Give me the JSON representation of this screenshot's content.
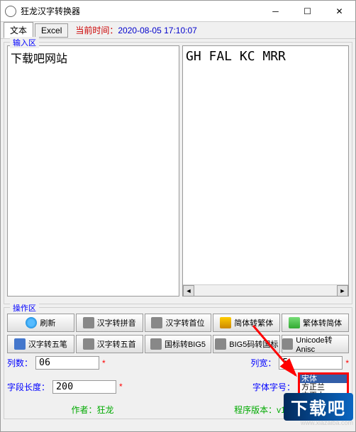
{
  "window": {
    "title": "狂龙汉字转换器"
  },
  "tabs": {
    "text": "文本",
    "excel": "Excel"
  },
  "time": {
    "label": "当前时间：",
    "value": "2020-08-05  17:10:07"
  },
  "sections": {
    "input": "输入区",
    "ops": "操作区"
  },
  "inputText": "下载吧网站",
  "outputText": "GH FAL KC MRR",
  "buttonsRow1": {
    "refresh": "刷新",
    "hz2py": "汉字转拼音",
    "hz2sw": "汉字转首位",
    "s2t": "简体转繁体",
    "t2s": "繁体转简体"
  },
  "buttonsRow2": {
    "hz2wb": "汉字转五笔",
    "hz2ws": "汉字转五首",
    "gb2b5": "国标转BIG5",
    "b52gb": "BIG5码转国标",
    "u2a": "Unicode转Anisc"
  },
  "stats": {
    "cols_label": "列数：",
    "cols_value": "06",
    "lenLabel": "字段长度：",
    "len_value": "200",
    "width_label": "列宽：",
    "width_value": "5",
    "font_label": "字体字号："
  },
  "credits": {
    "author": "作者：狂龙",
    "version": "程序版本：v1.0"
  },
  "fontOptions": {
    "sel": "宋体",
    "o1": "方正兰",
    "o2": "方正水"
  },
  "watermark": {
    "brand": "下载吧",
    "url": "www.xiazaiba.com"
  }
}
